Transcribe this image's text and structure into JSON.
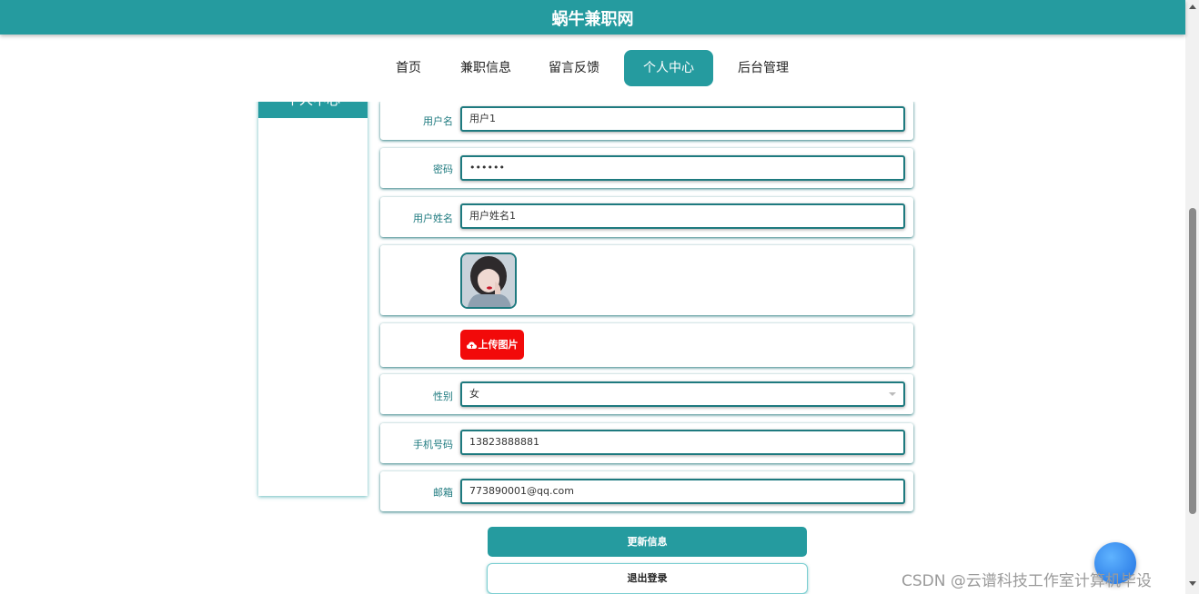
{
  "site": {
    "title": "蜗牛兼职网"
  },
  "nav": {
    "items": [
      {
        "label": "首页"
      },
      {
        "label": "兼职信息"
      },
      {
        "label": "留言反馈"
      },
      {
        "label": "个人中心",
        "active": true
      },
      {
        "label": "后台管理"
      }
    ]
  },
  "sidebar": {
    "title": "个人中心"
  },
  "form": {
    "username": {
      "label": "用户名",
      "value": "用户1"
    },
    "password": {
      "label": "密码",
      "value": "••••••"
    },
    "realname": {
      "label": "用户姓名",
      "value": "用户姓名1"
    },
    "avatar": {
      "icon": "avatar-image"
    },
    "upload": {
      "label": "上传图片",
      "icon": "cloud-upload-icon"
    },
    "gender": {
      "label": "性别",
      "value": "女"
    },
    "phone": {
      "label": "手机号码",
      "value": "13823888881"
    },
    "email": {
      "label": "邮箱",
      "value": "773890001@qq.com"
    }
  },
  "actions": {
    "update_label": "更新信息",
    "logout_label": "退出登录"
  },
  "watermark": "CSDN @云谱科技工作室计算机毕设",
  "colors": {
    "primary": "#259b9f",
    "upload": "#f20a0a"
  }
}
